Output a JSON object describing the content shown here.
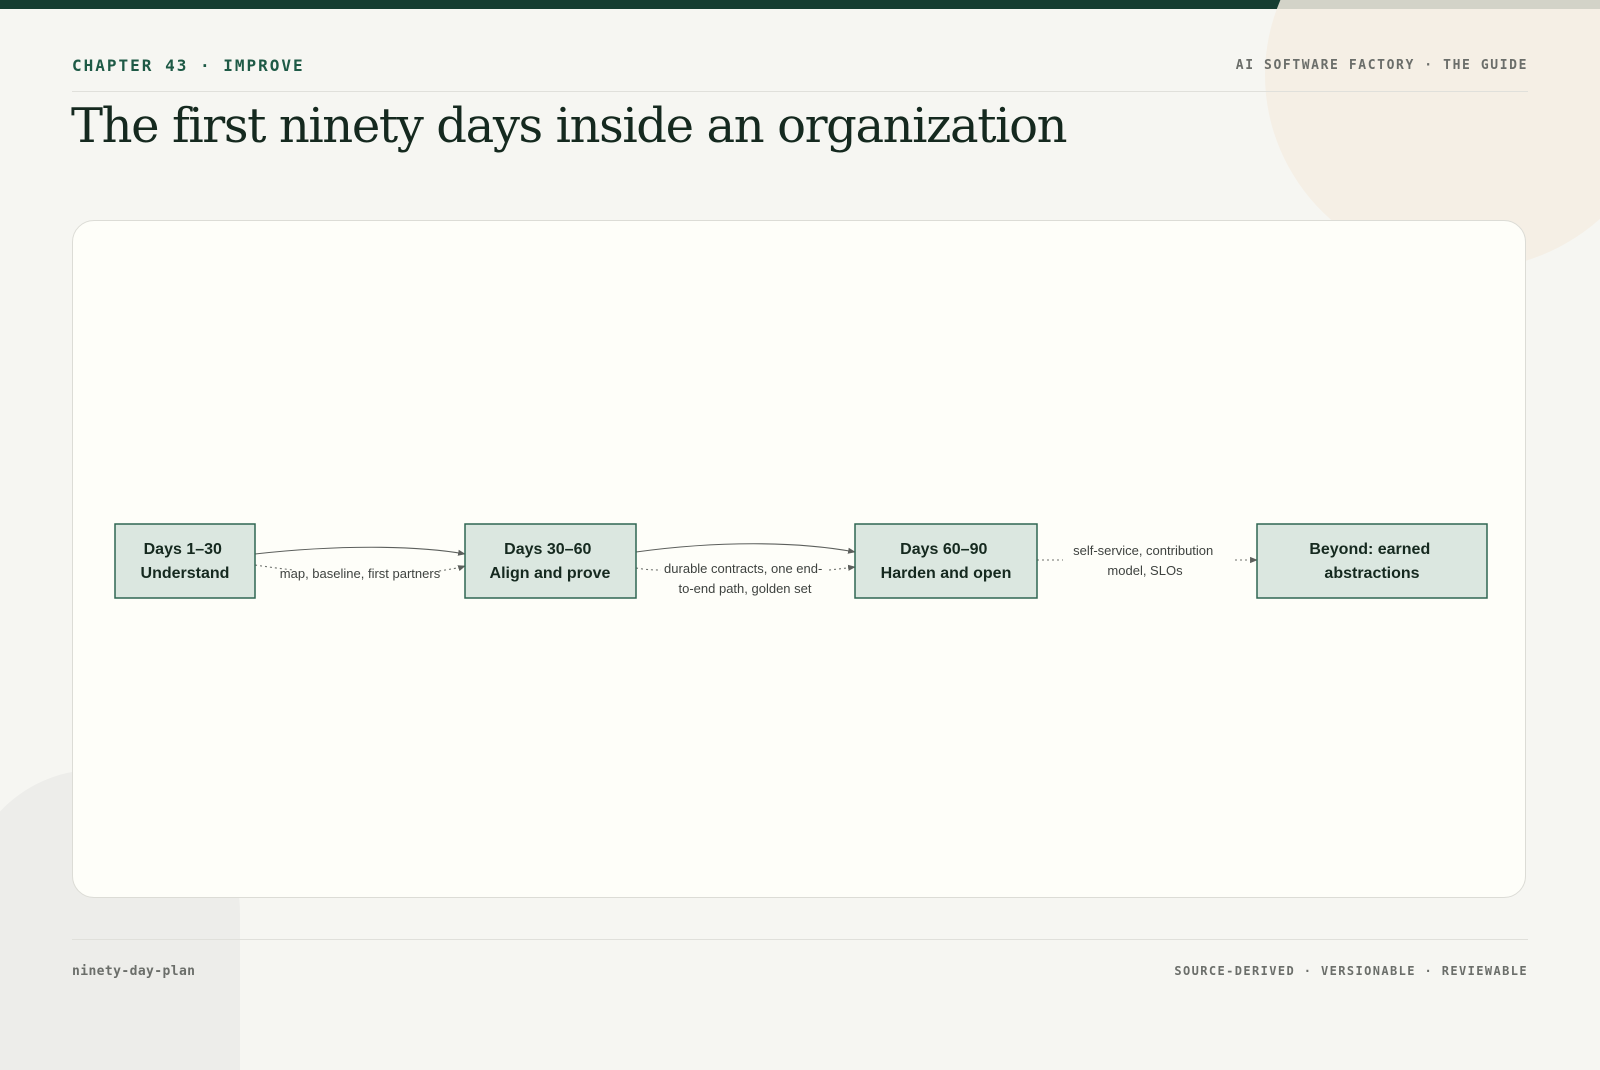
{
  "header": {
    "chapter": "CHAPTER 43 · IMPROVE",
    "guide": "AI SOFTWARE FACTORY · THE GUIDE",
    "title": "The first ninety days inside an organization"
  },
  "diagram": {
    "nodes": [
      {
        "id": "days-1-30",
        "lines": [
          "Days 1–30",
          "Understand"
        ]
      },
      {
        "id": "days-30-60",
        "lines": [
          "Days 30–60",
          "Align and prove"
        ]
      },
      {
        "id": "days-60-90",
        "lines": [
          "Days 60–90",
          "Harden and open"
        ]
      },
      {
        "id": "beyond",
        "lines": [
          "Beyond: earned",
          "abstractions"
        ]
      }
    ],
    "edges": [
      {
        "from": "days-1-30",
        "to": "days-30-60",
        "label": [
          "map, baseline, first partners"
        ]
      },
      {
        "from": "days-30-60",
        "to": "days-60-90",
        "label": [
          "durable contracts, one end-",
          "to-end path, golden set"
        ]
      },
      {
        "from": "days-60-90",
        "to": "beyond",
        "label": [
          "self-service, contribution",
          "model, SLOs"
        ]
      }
    ]
  },
  "footer": {
    "slug": "ninety-day-plan",
    "tags": "SOURCE-DERIVED · VERSIONABLE · REVIEWABLE"
  }
}
